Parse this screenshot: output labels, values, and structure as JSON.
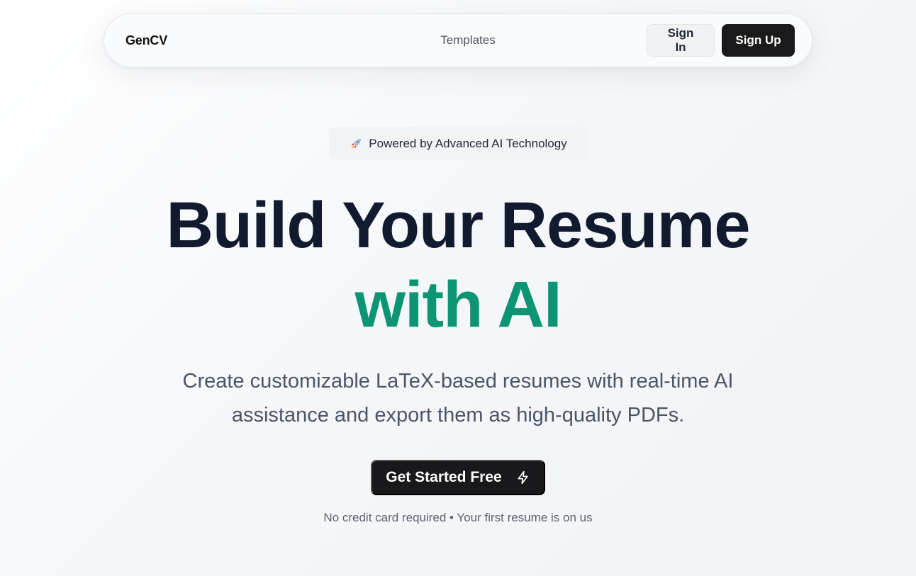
{
  "navbar": {
    "brand": "GenCV",
    "links": [
      {
        "label": "Templates"
      }
    ],
    "sign_in_label": "Sign In",
    "sign_up_label": "Sign Up"
  },
  "hero": {
    "badge": {
      "icon": "rocket-icon",
      "text": "Powered by Advanced AI Technology"
    },
    "title_line1": "Build Your Resume",
    "title_line2": "with AI",
    "subtitle": "Create customizable LaTeX-based resumes with real-time AI assistance and export them as high-quality PDFs.",
    "cta": {
      "label": "Get Started Free",
      "icon": "zap-icon"
    },
    "fineprint": "No credit card required • Your first resume is on us"
  },
  "colors": {
    "accent": "#0b9572",
    "title": "#111a2e",
    "button_dark": "#19191b"
  }
}
